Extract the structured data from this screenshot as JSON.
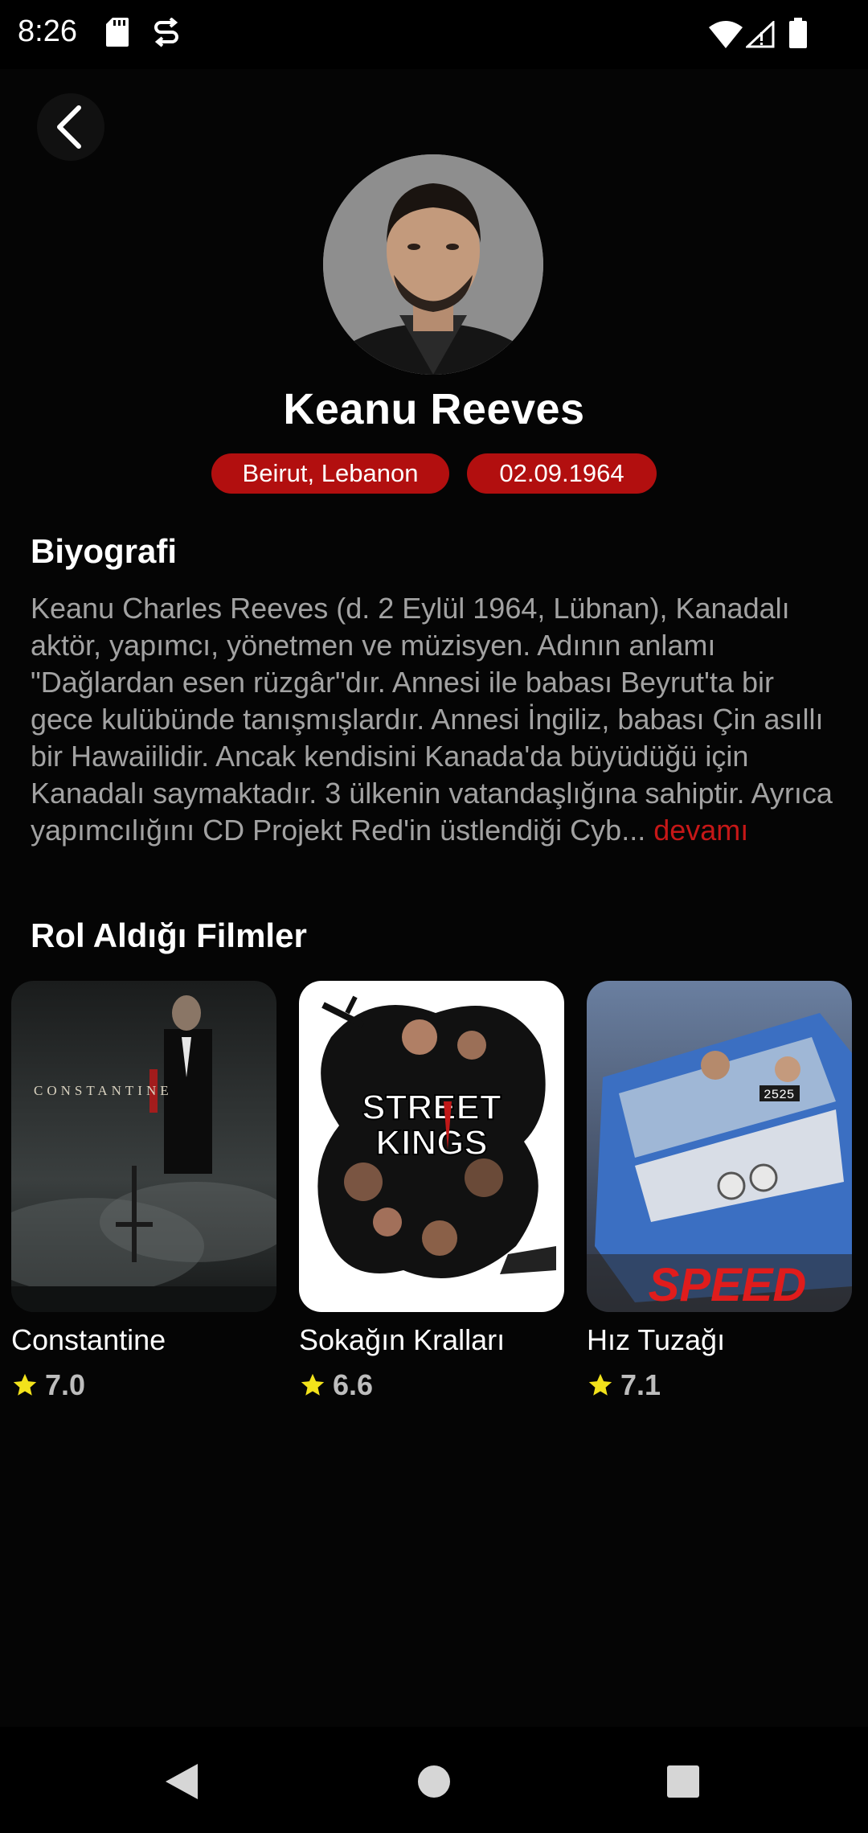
{
  "status_bar": {
    "time": "8:26",
    "icons": [
      "sd-card-icon",
      "sync-icon",
      "wifi-icon",
      "signal-icon",
      "battery-icon"
    ]
  },
  "toolbar": {
    "back_icon": "chevron-left-icon"
  },
  "actor": {
    "name": "Keanu Reeves",
    "birthplace": "Beirut, Lebanon",
    "birthdate": "02.09.1964"
  },
  "biography": {
    "title": "Biyografi",
    "text": "Keanu Charles Reeves (d. 2 Eylül 1964, Lübnan), Kanadalı aktör, yapımcı, yönetmen ve müzisyen. Adının anlamı \"Dağlardan esen rüzgâr\"dır. Annesi ile babası Beyrut'ta bir gece kulübünde tanışmışlardır. Annesi İngiliz, babası Çin asıllı bir Hawaiilidir. Ancak kendisini Kanada'da büyüdüğü için Kanadalı saymaktadır. 3 ülkenin vatandaşlığına sahiptir. Ayrıca yapımcılığını CD Projekt Red'in üstlendiği Cyb...",
    "read_more": "devamı"
  },
  "movies": {
    "title": "Rol Aldığı Filmler",
    "items": [
      {
        "title": "Constantine",
        "rating": "7.0",
        "poster_text": "CONSTANTINE"
      },
      {
        "title": "Sokağın Kralları",
        "rating": "6.6",
        "poster_text": "STREET KINGS"
      },
      {
        "title": "Hız Tuzağı",
        "rating": "7.1",
        "poster_text": "SPEED"
      }
    ]
  },
  "colors": {
    "background": "#050505",
    "accent_red": "#b20f0f",
    "link_red": "#c61717",
    "bio_text": "#a2a2a2",
    "star_yellow": "#f2e21b"
  },
  "nav_bar": {
    "icons": [
      "back-triangle-icon",
      "home-circle-icon",
      "recents-square-icon"
    ]
  }
}
